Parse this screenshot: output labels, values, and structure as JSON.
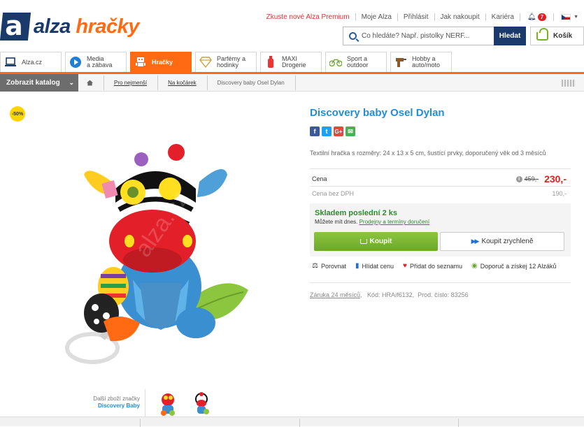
{
  "header": {
    "top_links": [
      "Zkuste nové Alza Premium",
      "Moje Alza",
      "Přihlásit",
      "Jak nakoupit",
      "Kariéra"
    ],
    "notifications_count": "7",
    "logo_word1": "alza",
    "logo_word2": "hračky",
    "search_placeholder": "Co hledáte? Např. pistolky NERF...",
    "search_button": "Hledat",
    "cart_label": "Košík"
  },
  "category_tabs": [
    {
      "line1": "Alza.cz",
      "line2": ""
    },
    {
      "line1": "Media",
      "line2": "a zábava"
    },
    {
      "line1": "Hračky",
      "line2": ""
    },
    {
      "line1": "Parfémy a",
      "line2": "hodinky"
    },
    {
      "line1": "MAXI",
      "line2": "Drogerie"
    },
    {
      "line1": "Sport a",
      "line2": "outdoor"
    },
    {
      "line1": "Hobby a",
      "line2": "auto/moto"
    }
  ],
  "catalog_button": "Zobrazit katalog",
  "breadcrumbs": [
    "Pro nejmenší",
    "Na kočárek",
    "Discovery baby Osel Dylan"
  ],
  "product": {
    "discount_badge": "-50%",
    "title": "Discovery baby Osel Dylan",
    "description": "Textilní hračka s rozměry: 24 x 13 x 5 cm, šustící prvky, doporučený věk od 3 měsíců",
    "price_label": "Cena",
    "old_price": "459,-",
    "new_price": "230,-",
    "vat_label": "Cena bez DPH",
    "vat_price": "190,-",
    "stock_title": "Skladem poslední 2 ks",
    "stock_sub_prefix": "Můžete mít dnes.",
    "stock_sub_link": "Prodejny a termíny doručení",
    "buy_button": "Koupit",
    "quick_buy_button": "Koupit zrychleně",
    "actions": [
      "Porovnat",
      "Hlídat cenu",
      "Přidat do seznamu",
      "Doporuč a získej 12 Alzáků"
    ],
    "warranty": "Záruka 24 měsíců",
    "code": "Kód: HRAif6132,",
    "prod_number": "Prod. číslo: 83256"
  },
  "thumbnails": {
    "label": "Další zboží značky",
    "brand": "Discovery Baby"
  },
  "colors": {
    "accent": "#ff6a13",
    "brand_navy": "#1a3a6b",
    "link_blue": "#1f8fd6",
    "price_red": "#e02020",
    "buy_green": "#7ab51d"
  }
}
